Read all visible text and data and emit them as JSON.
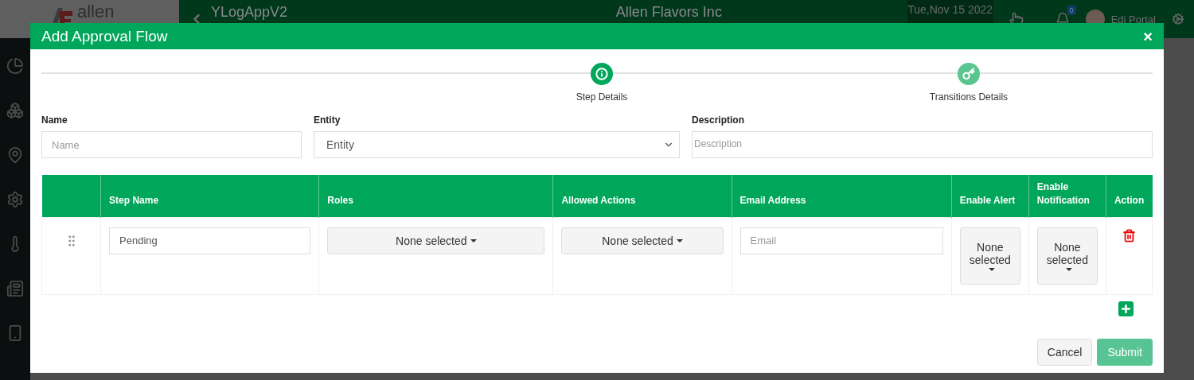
{
  "app": {
    "logo": "allen",
    "title": "YLogAppV2",
    "company": "Allen Flavors Inc",
    "date": "Tue,Nov 15 2022",
    "notification_count": "0",
    "user": "Edi Portal"
  },
  "modal": {
    "title": "Add Approval Flow",
    "close": "×",
    "steps": [
      {
        "label": "Step Details",
        "selected": true
      },
      {
        "label": "Transitions Details",
        "selected": false
      }
    ],
    "fields": [
      {
        "kind": "input",
        "label": "Name",
        "placeholder": "Name"
      },
      {
        "kind": "select",
        "label": "Entity",
        "value": "Entity"
      },
      {
        "kind": "textarea",
        "label": "Description",
        "placeholder": "Description"
      }
    ],
    "table": {
      "columns": [
        "Step Name",
        "Roles",
        "Allowed Actions",
        "Email Address",
        "Enable Alert",
        "Enable Notification",
        "Action"
      ],
      "rows": [
        {
          "step_name": "Pending",
          "roles": "None selected",
          "allowed_actions": "None selected",
          "email_placeholder": "Email",
          "enable_alert": "None selected",
          "enable_notification": "None selected"
        }
      ]
    },
    "buttons": [
      {
        "kind": "cancel",
        "label": "Cancel",
        "disabled": false
      },
      {
        "kind": "submit",
        "label": "Submit",
        "disabled": true
      }
    ]
  }
}
